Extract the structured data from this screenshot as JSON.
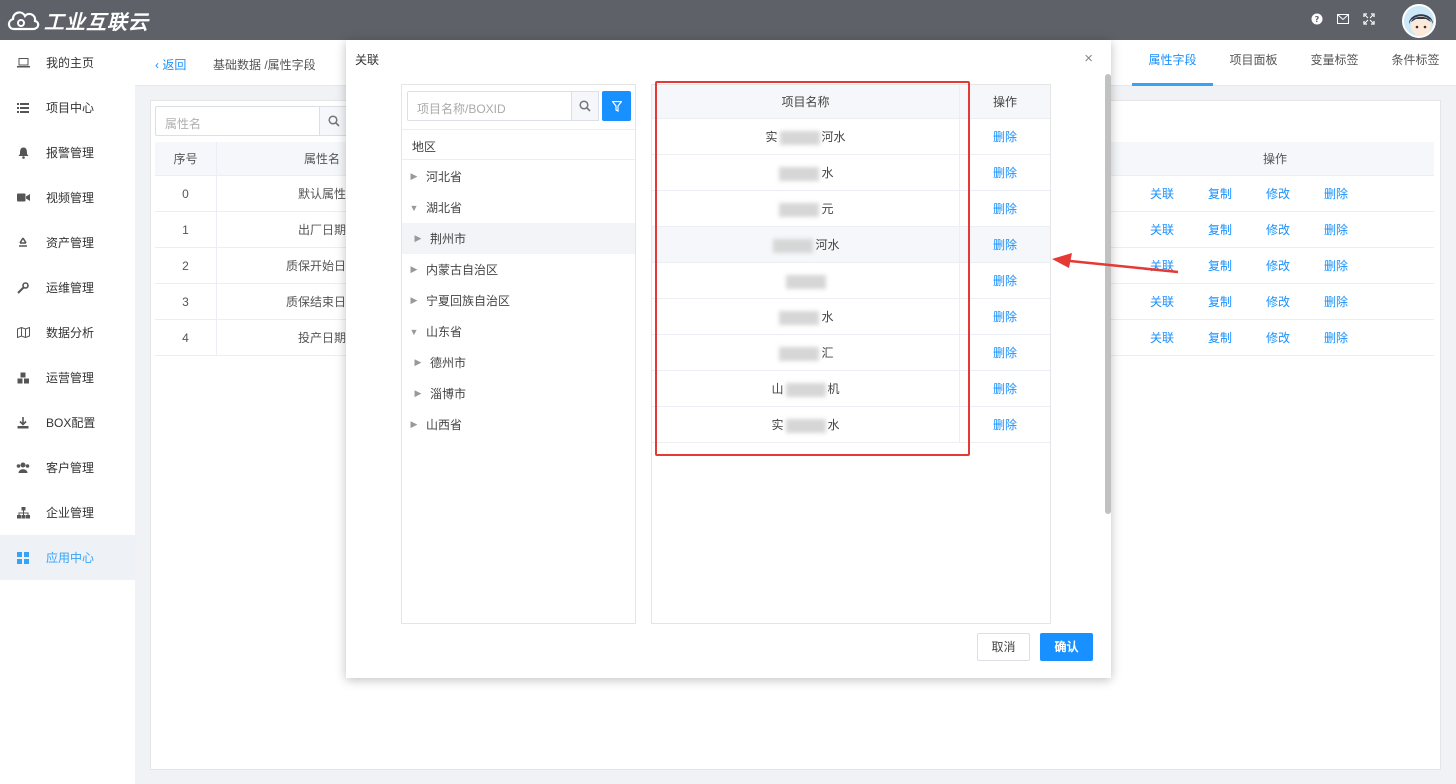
{
  "app": {
    "title": "工业互联云"
  },
  "sidebar": {
    "items": [
      {
        "label": "我的主页",
        "icon": "laptop-icon"
      },
      {
        "label": "项目中心",
        "icon": "list-icon"
      },
      {
        "label": "报警管理",
        "icon": "bell-icon"
      },
      {
        "label": "视频管理",
        "icon": "video-icon"
      },
      {
        "label": "资产管理",
        "icon": "recycle-icon"
      },
      {
        "label": "运维管理",
        "icon": "wrench-icon"
      },
      {
        "label": "数据分析",
        "icon": "map-icon"
      },
      {
        "label": "运营管理",
        "icon": "cubes-icon"
      },
      {
        "label": "BOX配置",
        "icon": "download-icon"
      },
      {
        "label": "客户管理",
        "icon": "users-icon"
      },
      {
        "label": "企业管理",
        "icon": "sitemap-icon"
      },
      {
        "label": "应用中心",
        "icon": "grid-icon"
      }
    ],
    "active_index": 11
  },
  "breadcrumb": {
    "back": "返回",
    "path": "基础数据 /属性字段"
  },
  "tabs": [
    "属性字段",
    "项目面板",
    "变量标签",
    "条件标签"
  ],
  "background_table": {
    "search_placeholder": "属性名",
    "headers": {
      "index": "序号",
      "name": "属性名",
      "ops": "操作"
    },
    "rows": [
      {
        "index": "0",
        "name": "默认属性"
      },
      {
        "index": "1",
        "name": "出厂日期"
      },
      {
        "index": "2",
        "name": "质保开始日期"
      },
      {
        "index": "3",
        "name": "质保结束日期"
      },
      {
        "index": "4",
        "name": "投产日期"
      }
    ],
    "ops": [
      "关联",
      "复制",
      "修改",
      "删除"
    ]
  },
  "modal": {
    "title": "关联",
    "search_placeholder": "项目名称/BOXID",
    "region_label": "地区",
    "tree": [
      {
        "label": "河北省",
        "level": 0,
        "expanded": false
      },
      {
        "label": "湖北省",
        "level": 0,
        "expanded": true
      },
      {
        "label": "荆州市",
        "level": 1,
        "expanded": false,
        "selected": true
      },
      {
        "label": "内蒙古自治区",
        "level": 0,
        "expanded": false
      },
      {
        "label": "宁夏回族自治区",
        "level": 0,
        "expanded": false
      },
      {
        "label": "山东省",
        "level": 0,
        "expanded": true
      },
      {
        "label": "德州市",
        "level": 1,
        "expanded": false
      },
      {
        "label": "淄博市",
        "level": 1,
        "expanded": false
      },
      {
        "label": "山西省",
        "level": 0,
        "expanded": false
      }
    ],
    "table": {
      "headers": {
        "name": "项目名称",
        "op": "操作"
      },
      "rows": [
        {
          "prefix": "实",
          "suffix": "河水",
          "op": "删除"
        },
        {
          "prefix": "",
          "suffix": "水",
          "op": "删除"
        },
        {
          "prefix": "",
          "suffix": "元",
          "op": "删除"
        },
        {
          "prefix": "",
          "suffix": "河水",
          "op": "删除"
        },
        {
          "prefix": "",
          "suffix": "",
          "op": "删除"
        },
        {
          "prefix": "",
          "suffix": "水",
          "op": "删除"
        },
        {
          "prefix": "",
          "suffix": "汇",
          "op": "删除"
        },
        {
          "prefix": "山",
          "suffix": "机",
          "op": "删除"
        },
        {
          "prefix": "实",
          "suffix": "水",
          "op": "删除"
        }
      ]
    },
    "cancel": "取消",
    "confirm": "确认"
  },
  "colors": {
    "topbar": "#5e6168",
    "primary": "#1890ff",
    "accent": "#36a3f7",
    "annotation_red": "#e53935"
  }
}
